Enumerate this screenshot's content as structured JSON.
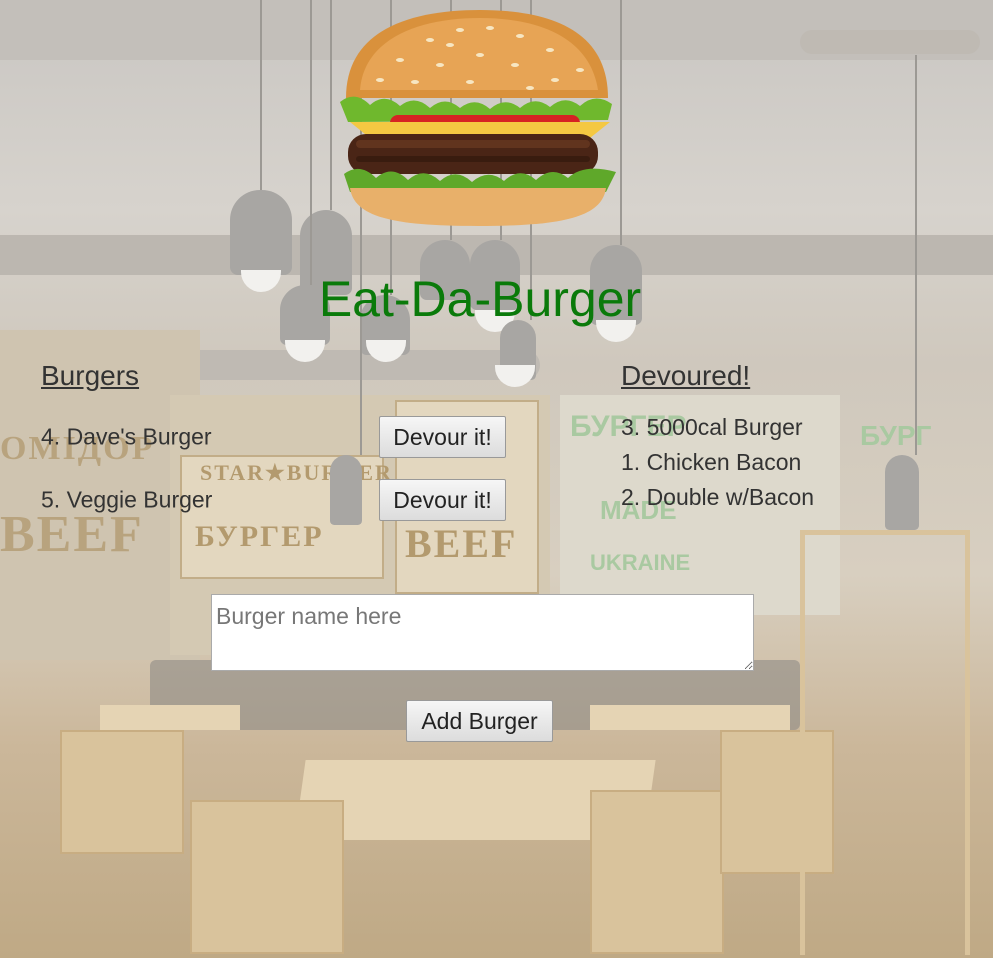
{
  "site": {
    "title": "Eat-Da-Burger",
    "title_color": "#0a7a0a"
  },
  "logo": {
    "icon": "hamburger-icon"
  },
  "burgers": {
    "heading": "Burgers",
    "items": [
      {
        "label": "4. Dave's Burger",
        "button_label": "Devour it!"
      },
      {
        "label": "5. Veggie Burger",
        "button_label": "Devour it!"
      }
    ]
  },
  "devoured": {
    "heading": "Devoured!",
    "items": [
      "3. 5000cal Burger",
      "1. Chicken Bacon",
      "2. Double w/Bacon"
    ]
  },
  "form": {
    "placeholder": "Burger name here",
    "value": "",
    "submit_label": "Add Burger"
  }
}
